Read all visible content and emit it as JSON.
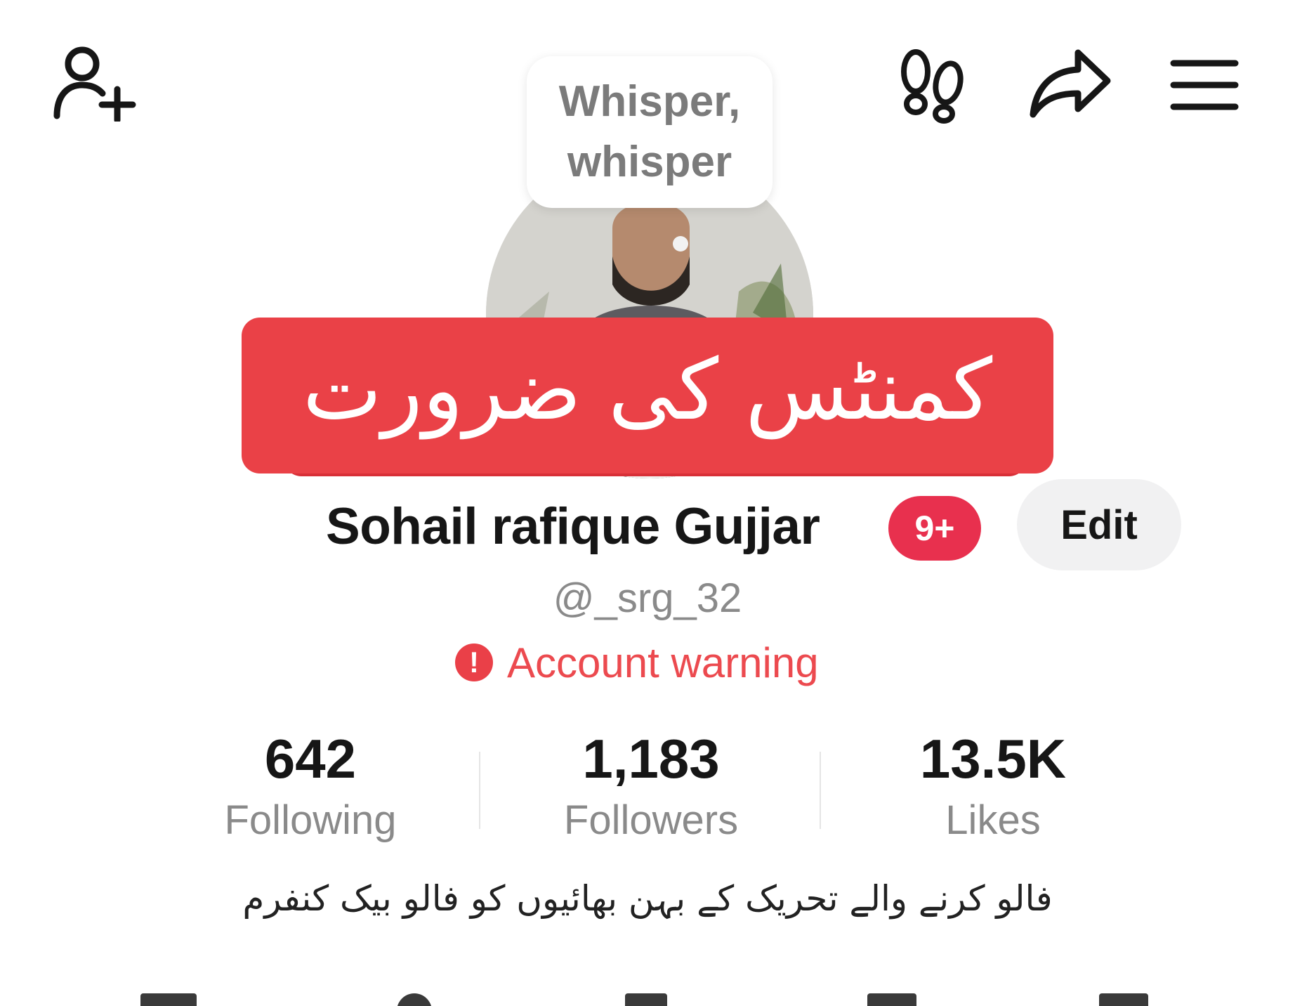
{
  "header": {
    "icons": [
      "add-friend-icon",
      "footprint-icon",
      "share-icon",
      "menu-icon"
    ]
  },
  "whisper": {
    "text": "Whisper, whisper"
  },
  "banner": {
    "text": "کمنٹس کی ضرورت"
  },
  "profile": {
    "name": "Sohail rafique Gujjar",
    "badge": "9+",
    "edit_label": "Edit",
    "handle": "@_srg_32",
    "warning": "Account warning",
    "bio": "فالو کرنے والے تحریک کے بہن بھائیوں کو فالو بیک کنفرم"
  },
  "stats": [
    {
      "count": "642",
      "label": "Following"
    },
    {
      "count": "1,183",
      "label": "Followers"
    },
    {
      "count": "13.5K",
      "label": "Likes"
    }
  ],
  "colors": {
    "banner": "#ea4147",
    "badge": "#e8304e",
    "warning": "#ec4a4f",
    "muted_text": "#8a8a8a"
  }
}
